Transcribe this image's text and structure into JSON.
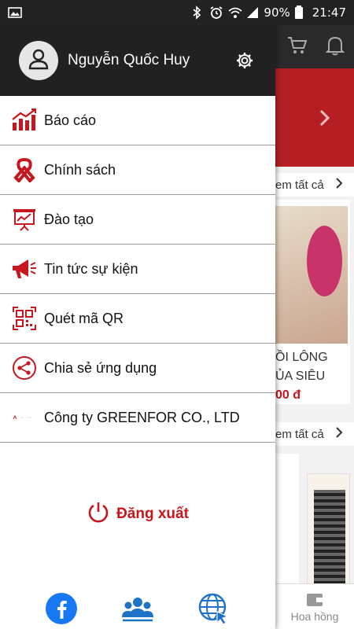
{
  "status_bar": {
    "battery": "90%",
    "time": "21:47"
  },
  "drawer": {
    "user_name": "Nguyễn Quốc Huy",
    "menu": [
      {
        "label": "Báo cáo",
        "icon": "bar-chart-icon"
      },
      {
        "label": "Chính sách",
        "icon": "ribbon-icon"
      },
      {
        "label": "Đào tạo",
        "icon": "presentation-icon"
      },
      {
        "label": "Tin tức sự kiện",
        "icon": "megaphone-icon"
      },
      {
        "label": "Quét mã QR",
        "icon": "qr-code-icon"
      },
      {
        "label": "Chia sẻ ứng dụng",
        "icon": "share-icon"
      },
      {
        "label": "Công ty GREENFOR CO., LTD",
        "icon": "company-logo-icon"
      }
    ],
    "logout_label": "Đăng xuất",
    "footer_icons": [
      "facebook-icon",
      "users-icon",
      "web-icon"
    ]
  },
  "background": {
    "see_all_1": "em tất cả",
    "see_all_2": "em tất cả",
    "product_line1": "ỒI LÔNG",
    "product_line2": "ỦA SIÊU",
    "product_price": "00 đ",
    "bottom_tab_label": "Hoa hồng"
  },
  "colors": {
    "accent_red": "#c7161d",
    "header_dark": "#212121",
    "facebook_blue": "#1877f2",
    "icon_blue": "#1e73c8"
  }
}
